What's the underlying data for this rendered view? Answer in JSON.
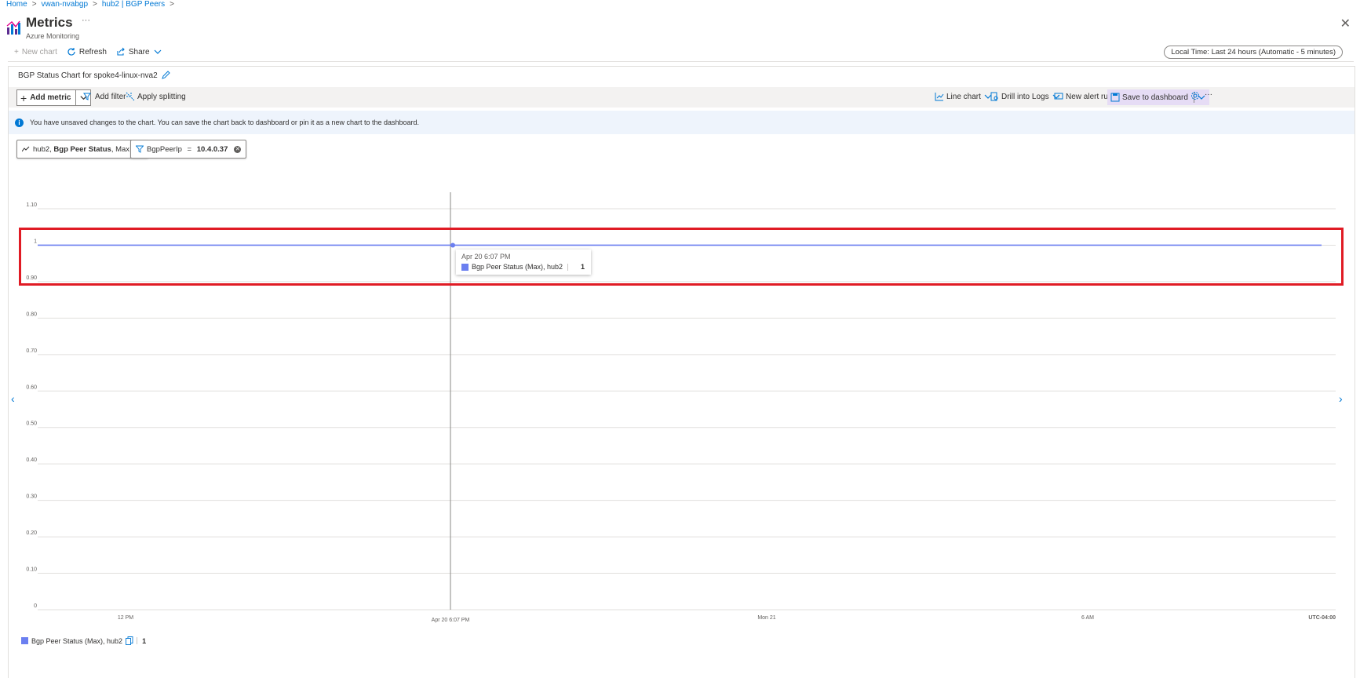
{
  "breadcrumb": [
    "Home",
    "vwan-nvabgp",
    "hub2 | BGP Peers"
  ],
  "header": {
    "title": "Metrics",
    "subtitle": "Azure Monitoring",
    "more": "···"
  },
  "commandbar": {
    "new_chart": "New chart",
    "refresh": "Refresh",
    "share": "Share"
  },
  "time_range": "Local Time: Last 24 hours (Automatic - 5 minutes)",
  "chart": {
    "title": "BGP Status Chart for spoke4-linux-nva2",
    "toolbar": {
      "add_metric": "Add metric",
      "add_filter": "Add filter",
      "apply_splitting": "Apply splitting",
      "line_chart": "Line chart",
      "drill_logs": "Drill into Logs",
      "new_alert": "New alert rule",
      "save_dashboard": "Save to dashboard",
      "more": "···"
    },
    "info": "You have unsaved changes to the chart. You can save the chart back to dashboard or pin it as a new chart to the dashboard.",
    "metric_pill": {
      "prefix": "hub2, ",
      "metric": "Bgp Peer Status",
      "agg": ", Max"
    },
    "filter_pill": {
      "key": "BgpPeerIp",
      "op": " = ",
      "value": "10.4.0.37"
    },
    "tooltip": {
      "time": "Apr 20 6:07 PM",
      "series": "Bgp Peer Status (Max), hub2",
      "value": "1"
    },
    "legend": {
      "series": "Bgp Peer Status (Max), hub2",
      "value": "1"
    }
  },
  "colors": {
    "series": "#6b7ff0",
    "highlight": "#e01b24",
    "accent": "#0078d4"
  },
  "chart_data": {
    "type": "line",
    "series": [
      {
        "name": "Bgp Peer Status (Max), hub2",
        "x": [
          "start",
          "end"
        ],
        "values": [
          1,
          1
        ]
      }
    ],
    "y_ticks": [
      "0",
      "0.10",
      "0.20",
      "0.30",
      "0.40",
      "0.50",
      "0.60",
      "0.70",
      "0.80",
      "0.90",
      "1",
      "1.10"
    ],
    "x_ticks": [
      "12 PM",
      "Apr 20 6:07 PM",
      "Mon 21",
      "6 AM",
      "UTC-04:00"
    ],
    "ylim": [
      0,
      1.1
    ],
    "grid": true,
    "crosshair": "Apr 20 6:07 PM"
  }
}
